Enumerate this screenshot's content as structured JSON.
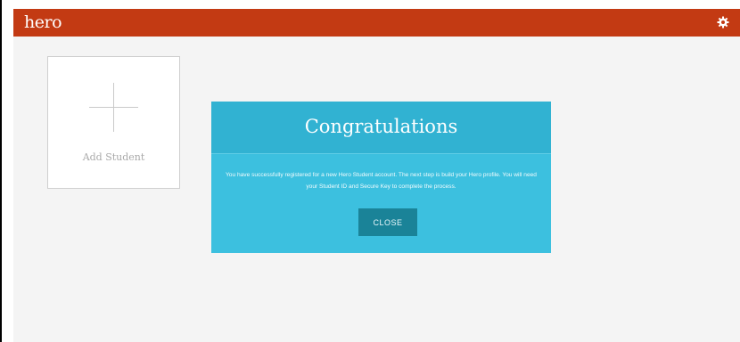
{
  "header": {
    "logo_text": "hero",
    "brand_color": "#c33a13",
    "settings_icon": "gear-icon"
  },
  "add_student": {
    "icon": "plus-icon",
    "label": "Add Student"
  },
  "modal": {
    "title": "Congratulations",
    "message": "You have successfully registered for a new Hero Student account. The next step is build your Hero profile. You will need your Student ID and Secure Key to complete the process.",
    "close_label": "CLOSE",
    "accent_color": "#3cc0df",
    "button_color": "#1a8398"
  }
}
